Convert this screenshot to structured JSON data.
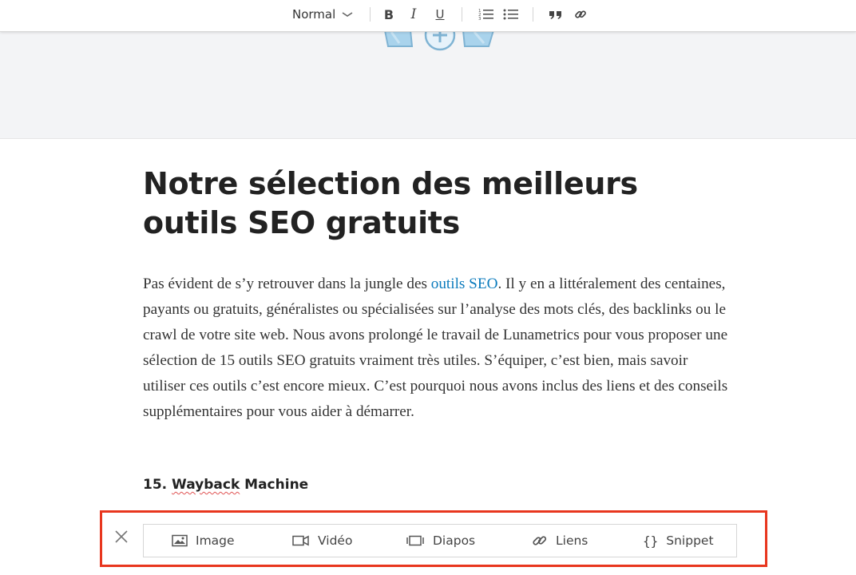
{
  "toolbar": {
    "style_select": "Normal",
    "bold_glyph": "B",
    "italic_glyph": "I",
    "underline_glyph": "U",
    "icons": [
      "chevron-down-icon",
      "numbered-list-icon",
      "bulleted-list-icon",
      "quote-icon",
      "link-icon"
    ]
  },
  "cover": {
    "icon": "add-image-icon"
  },
  "article": {
    "title": "Notre sélection des meilleurs outils SEO gratuits",
    "paragraph": {
      "before_link": " Pas évident de s’y retrouver dans la jungle des ",
      "link_text": "outils SEO",
      "after_link": ". Il y en a littéralement des centaines, payants ou gratuits, généralistes ou spécialisées sur l’analyse des mots clés, des backlinks ou le crawl de votre site web. Nous avons prolongé le travail de Lunametrics pour vous proposer une sélection de 15 outils SEO gratuits vraiment très utiles. S’équiper, c’est bien, mais savoir utiliser ces outils c’est encore mieux. C’est pourquoi nous avons inclus des liens et des conseils supplémentaires pour vous aider à démarrer."
    },
    "subheading": {
      "number": "15. ",
      "name_underlined": "Wayback",
      "name_rest": " Machine"
    }
  },
  "insert_bar": {
    "items": [
      {
        "label": "Image",
        "icon": "image-icon"
      },
      {
        "label": "Vidéo",
        "icon": "video-icon"
      },
      {
        "label": "Diapos",
        "icon": "slides-icon"
      },
      {
        "label": "Liens",
        "icon": "link-icon"
      },
      {
        "label": "Snippet",
        "icon": "code-braces-icon"
      }
    ],
    "close_icon": "close-icon"
  },
  "colors": {
    "link": "#0b7bbd",
    "highlight_frame": "#e8361e",
    "cover_bg": "#f3f4f6",
    "illustration": "#9ecde8"
  }
}
